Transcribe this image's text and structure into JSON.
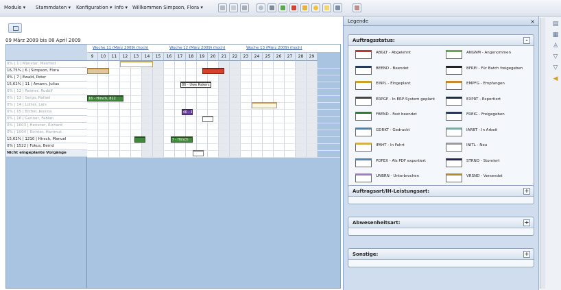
{
  "menu": {
    "items": [
      "Module ▾",
      "Stammdaten ▾",
      "Konfiguration ▾",
      "Info ▾",
      "Willkommen Simpson, Flora ▾"
    ]
  },
  "toolbar_icons": [
    "edit-icon",
    "copy-icon",
    "paste-icon",
    "refresh-icon",
    "print-icon",
    "filter-icon",
    "calendar-icon",
    "export-icon",
    "help-icon",
    "info-icon",
    "settings-icon",
    "user-icon"
  ],
  "gantt": {
    "date_range": "09 März 2009 bis 08 April 2009",
    "weeks": [
      {
        "label": "Woche 11 (März 2009) (hoch)"
      },
      {
        "label": "Woche 12 (März 2009) (hoch)"
      },
      {
        "label": "Woche 13 (März 2009) (hoch)"
      }
    ],
    "days": [
      "9",
      "10",
      "11",
      "12",
      "13",
      "14",
      "15",
      "16",
      "17",
      "18",
      "19",
      "20",
      "21",
      "22",
      "23",
      "24",
      "25",
      "26",
      "27",
      "28",
      "29"
    ],
    "weekend_flags": [
      false,
      false,
      false,
      false,
      false,
      true,
      true,
      false,
      false,
      false,
      false,
      false,
      true,
      true,
      false,
      false,
      false,
      false,
      false,
      true,
      true
    ],
    "rows": [
      {
        "label": "0% | 1 | Manstar, Manfred",
        "dim": true
      },
      {
        "label": "16,75% | 6 | Simpson, Flora",
        "dim": false
      },
      {
        "label": "0% | 7 | Ewald, Peter",
        "dim": false
      },
      {
        "label": "15,62% | 11 | Amann, Julius",
        "dim": false
      },
      {
        "label": "0% | 12 | Reimer, Rudolf",
        "dim": true
      },
      {
        "label": "0% | 13 | Sergo, Rafael",
        "dim": true
      },
      {
        "label": "0% | 14 | Lütter, Lars",
        "dim": true
      },
      {
        "label": "0% | 15 | Bichel, Jessica",
        "dim": true
      },
      {
        "label": "0% | 16 | Gunner, Fabian",
        "dim": true
      },
      {
        "label": "0% | 1003 | Hensner, Richard",
        "dim": true
      },
      {
        "label": "0% | 1004 | Richter, Hartmut",
        "dim": true
      },
      {
        "label": "15,62% | 1210 | Hirsch, Manuel",
        "dim": false
      },
      {
        "label": "0% | 1522 | Fokus, Bernd",
        "dim": false
      },
      {
        "label": "Nicht eingeplante Vorgänge",
        "bold": true
      }
    ],
    "bars": [
      {
        "row": 0,
        "start": 3,
        "span": 3,
        "color": "#ffffff",
        "border": "#c9a24a",
        "text": ""
      },
      {
        "row": 1,
        "start": 0,
        "span": 2,
        "color": "#d9c8a0",
        "border": "#b07d3a",
        "text": ""
      },
      {
        "row": 1,
        "start": 10.5,
        "span": 2,
        "color": "#d8402a",
        "border": "#8b1d12",
        "text": ""
      },
      {
        "row": 3,
        "start": 8.5,
        "span": 2.8,
        "color": "#ffffff",
        "border": "#333333",
        "text": "86 - Uwe Rakers"
      },
      {
        "row": 5,
        "start": 0,
        "span": 3.3,
        "color": "#3f8a3a",
        "border": "#234f20",
        "text": "16 - Hirsch, 812"
      },
      {
        "row": 6,
        "start": 15,
        "span": 2.3,
        "color": "#fff6e0",
        "border": "#c09a50",
        "text": ""
      },
      {
        "row": 7,
        "start": 8.6,
        "span": 1,
        "color": "#6a3fa0",
        "border": "#3b2260",
        "text": "40 - 1"
      },
      {
        "row": 8,
        "start": 10.5,
        "span": 1,
        "color": "#ffffff",
        "border": "#777777",
        "text": ""
      },
      {
        "row": 11,
        "start": 4.3,
        "span": 1,
        "color": "#3f8a3a",
        "border": "#234f20",
        "text": ""
      },
      {
        "row": 11,
        "start": 7.6,
        "span": 2,
        "color": "#3f8a3a",
        "border": "#234f20",
        "text": "7 - Hirsch"
      },
      {
        "row": 13,
        "start": 9.6,
        "span": 1,
        "color": "#ffffff",
        "border": "#777777",
        "text": ""
      }
    ]
  },
  "panel": {
    "title": "Legende",
    "sections": {
      "status": {
        "title": "Auftragsstatus:",
        "toggle": "-"
      },
      "type": {
        "title": "Auftragsart/IH-Leistungsart:",
        "toggle": "+"
      },
      "absence": {
        "title": "Abwesenheitsart:",
        "toggle": "+"
      },
      "other": {
        "title": "Sonstige:",
        "toggle": "+"
      }
    },
    "legend_items": [
      {
        "text": "ABGLT - Abgelehnt",
        "color": "#c0392b"
      },
      {
        "text": "ANGNM - Angenommen",
        "color": "#6aa84f"
      },
      {
        "text": "BEEND - Beendet",
        "color": "#24395c"
      },
      {
        "text": "BFREI - Für Batch freigegeben",
        "color": "#222222"
      },
      {
        "text": "EINPL - Eingeplant",
        "color": "#c9a227"
      },
      {
        "text": "EMPFG - Empfangen",
        "color": "#c98a2a"
      },
      {
        "text": "ERPGP - In ERP-System geplant",
        "color": "#444444"
      },
      {
        "text": "EXPRT - Exportiert",
        "color": "#1c2e4a"
      },
      {
        "text": "FBEND - Fast beendet",
        "color": "#2e7d32"
      },
      {
        "text": "FREIG - Freigegeben",
        "color": "#1f3a66"
      },
      {
        "text": "GDRKT - Gedruckt",
        "color": "#5d7f9c"
      },
      {
        "text": "IARBT - In Arbeit",
        "color": "#7fa7a5"
      },
      {
        "text": "IFAHT - In Fahrt",
        "color": "#d4b04a"
      },
      {
        "text": "INITL - Neu",
        "color": "#9c9c9c"
      },
      {
        "text": "PDFEX - Als PDF exportiert",
        "color": "#5c7fb3"
      },
      {
        "text": "STRNO - Storniert",
        "color": "#222255"
      },
      {
        "text": "UNBRN - Unterbrochen",
        "color": "#a07fc0"
      },
      {
        "text": "VRSND - Versendet",
        "color": "#b98b2f"
      }
    ]
  }
}
